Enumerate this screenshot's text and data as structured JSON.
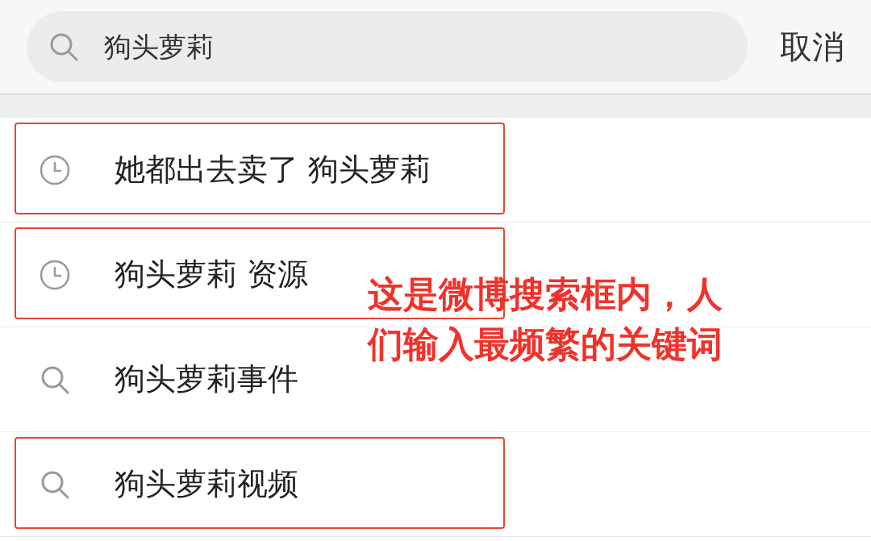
{
  "search": {
    "value": "狗头萝莉",
    "cancel": "取消"
  },
  "rows": [
    {
      "kind": "history",
      "text": "她都出去卖了 狗头萝莉",
      "highlighted": true
    },
    {
      "kind": "history",
      "text": "狗头萝莉 资源",
      "highlighted": true
    },
    {
      "kind": "suggestion",
      "text": "狗头萝莉事件",
      "highlighted": false
    },
    {
      "kind": "suggestion",
      "text": "狗头萝莉视频",
      "highlighted": true
    }
  ],
  "annotation": {
    "lines": [
      "这是微博搜索框内，人",
      "们输入最频繁的关键词"
    ]
  }
}
